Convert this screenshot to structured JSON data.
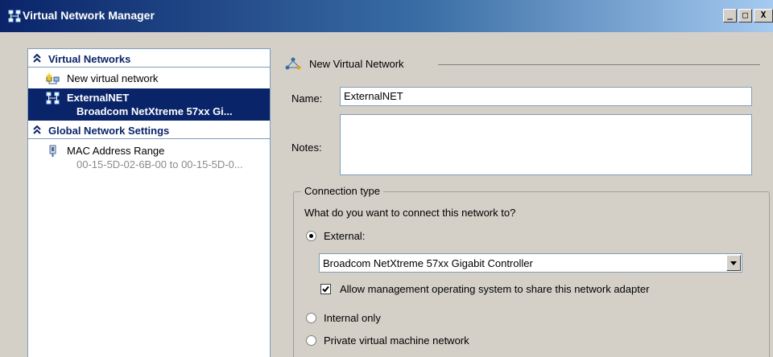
{
  "window": {
    "title": "Virtual Network Manager",
    "min_glyph": "_",
    "max_glyph": "□",
    "close_glyph": "X"
  },
  "sidebar": {
    "virtual_networks_header": "Virtual Networks",
    "items": [
      {
        "title": "New virtual network",
        "subtitle": ""
      },
      {
        "title": "ExternalNET",
        "subtitle": "Broadcom NetXtreme 57xx Gi..."
      }
    ],
    "global_header": "Global Network Settings",
    "global_items": [
      {
        "title": "MAC Address Range",
        "subtitle": "00-15-5D-02-6B-00 to 00-15-5D-0..."
      }
    ],
    "chevron": "⌃"
  },
  "main": {
    "section_title": "New Virtual Network",
    "name_label": "Name:",
    "name_value": "ExternalNET",
    "notes_label": "Notes:",
    "notes_value": "",
    "connection_type": {
      "legend": "Connection type",
      "question": "What do you want to connect this network to?",
      "options": [
        {
          "label": "External:",
          "selected": true
        },
        {
          "label": "Internal only",
          "selected": false
        },
        {
          "label": "Private virtual machine network",
          "selected": false
        }
      ],
      "adapter_value": "Broadcom NetXtreme 57xx Gigabit Controller",
      "allow_management_label": "Allow management operating system to share this network adapter",
      "allow_management_checked": true
    }
  },
  "colors": {
    "selection": "#0a246a",
    "titlebar": "#0a246a",
    "header_text": "#0a246a",
    "panel_bg": "#d4d0c8"
  }
}
